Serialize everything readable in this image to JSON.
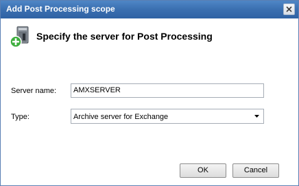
{
  "window": {
    "title": "Add Post Processing scope"
  },
  "header": {
    "title": "Specify the server for Post Processing",
    "icon": "server-add-icon"
  },
  "form": {
    "server_name": {
      "label": "Server name:",
      "value": "AMXSERVER"
    },
    "type": {
      "label": "Type:",
      "selected": "Archive server for Exchange"
    }
  },
  "buttons": {
    "ok": "OK",
    "cancel": "Cancel"
  }
}
